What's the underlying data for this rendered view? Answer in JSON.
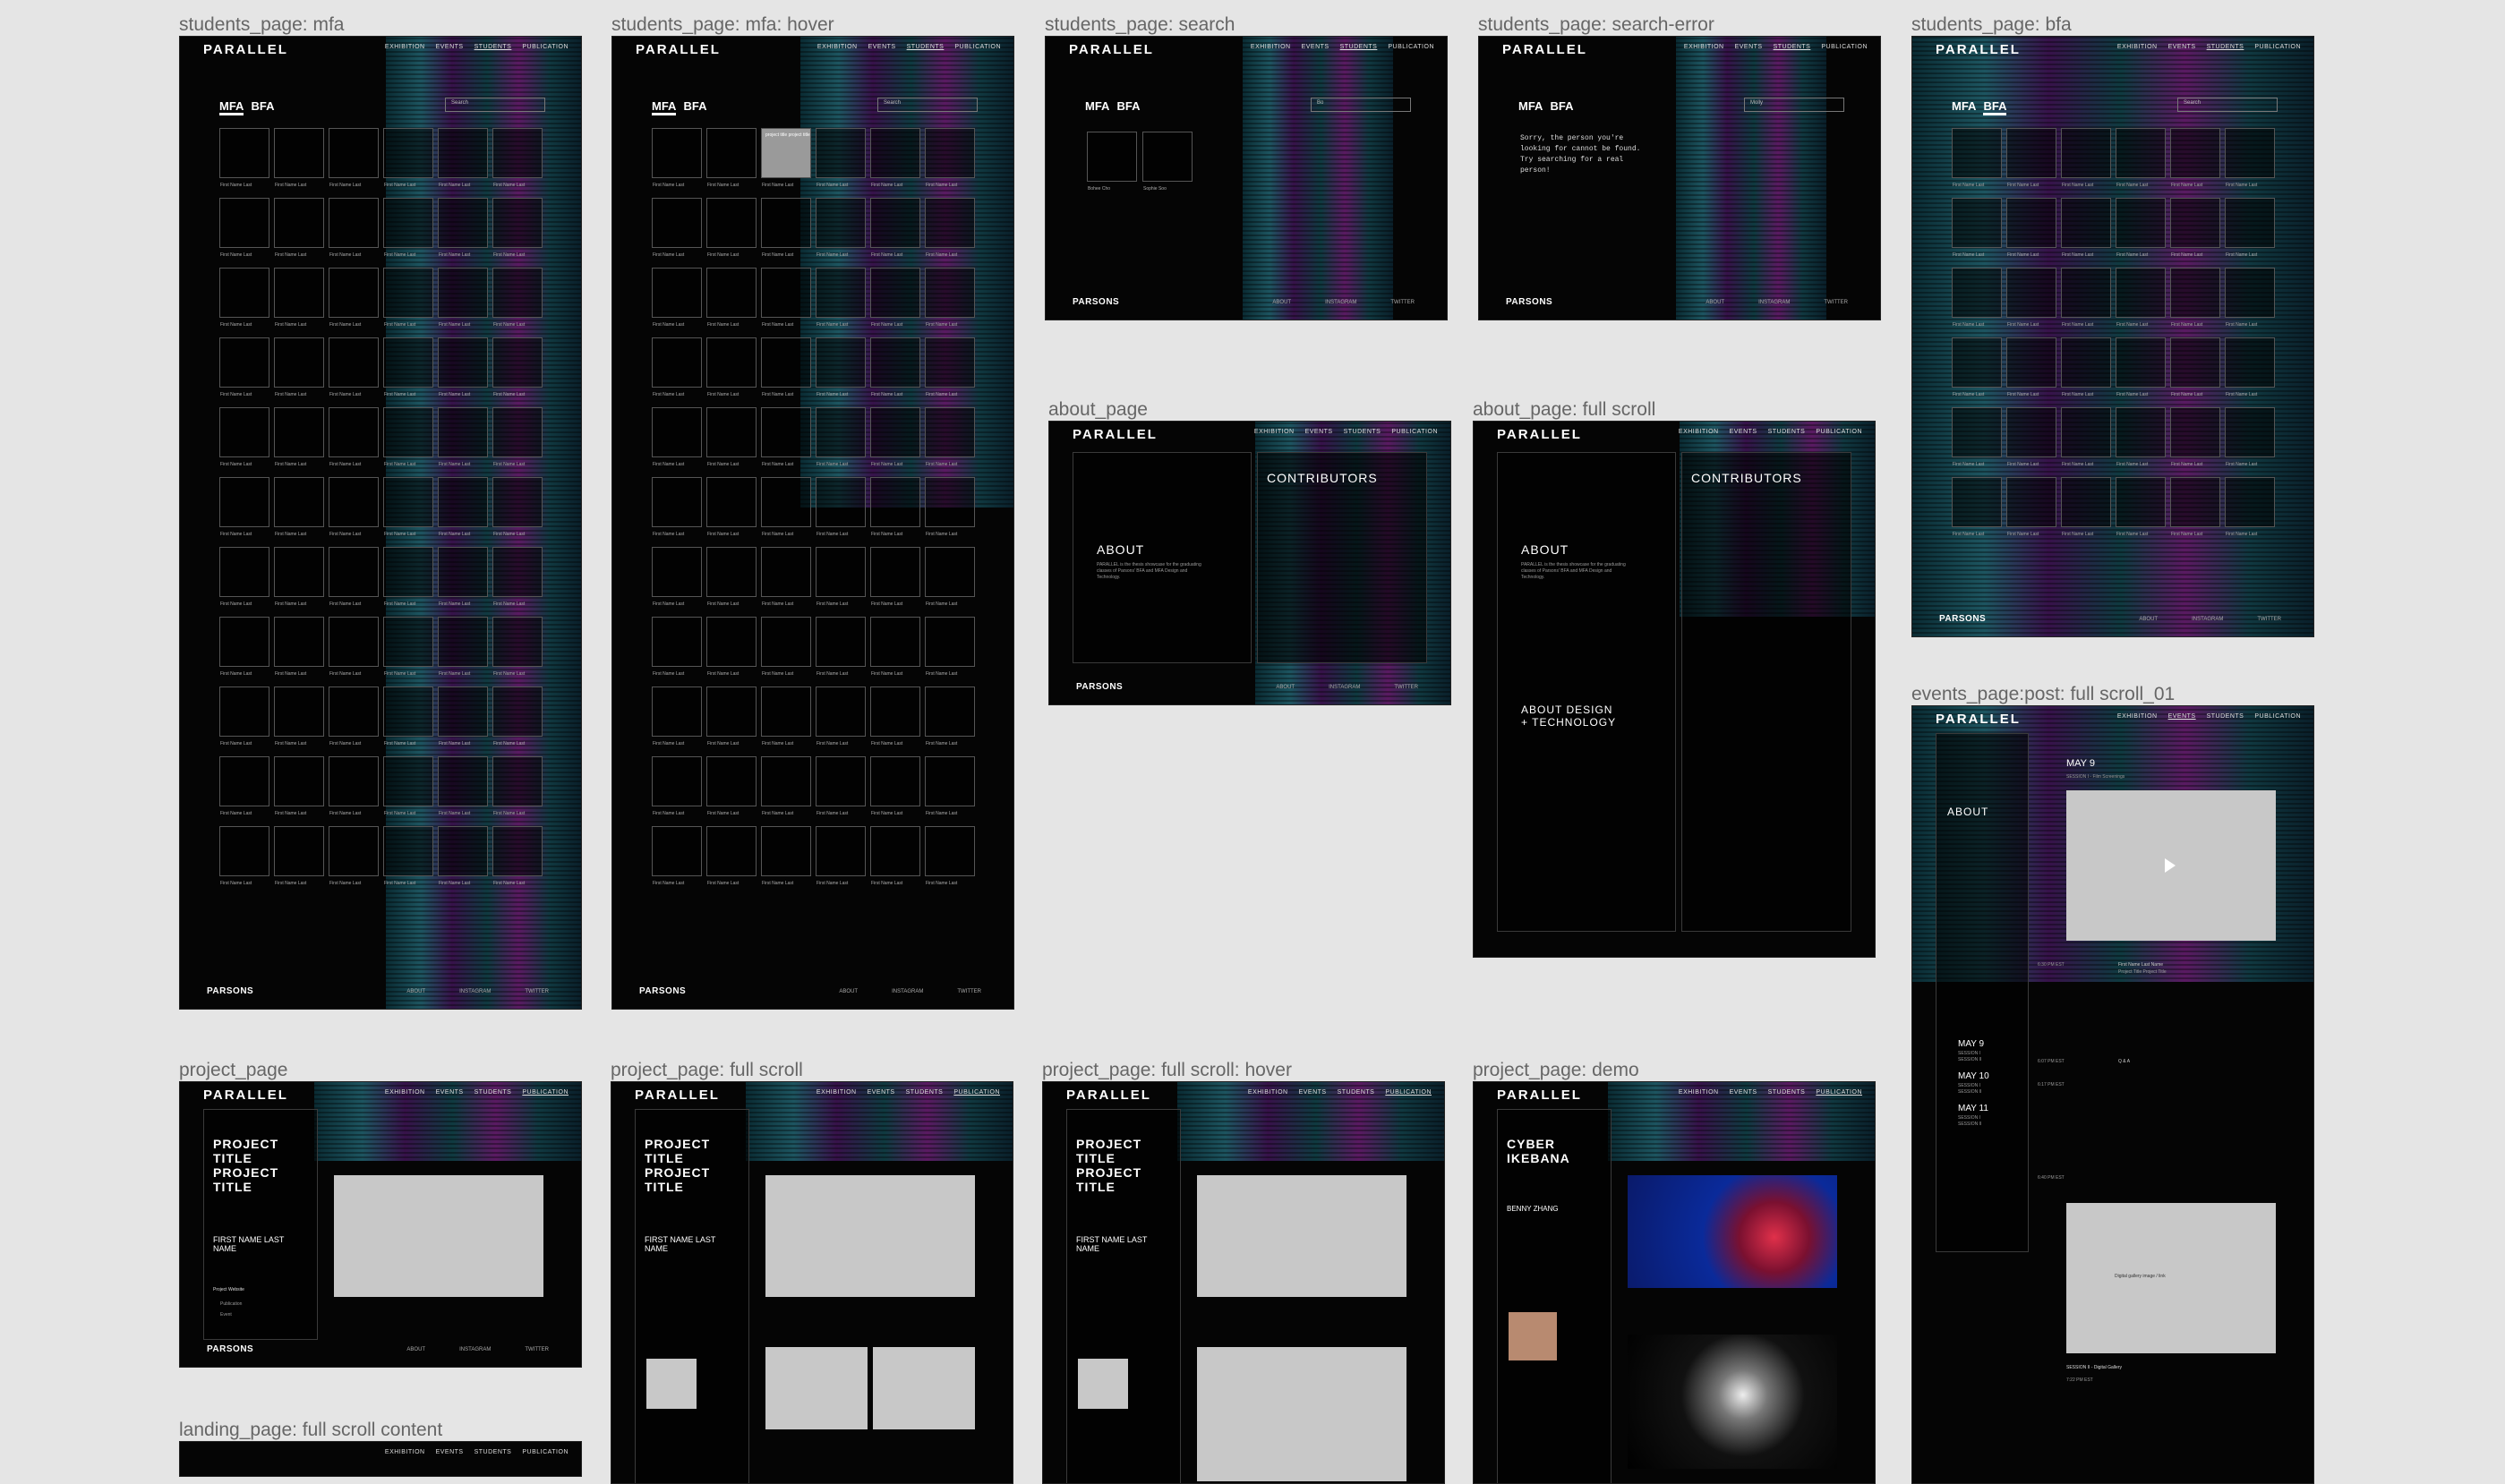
{
  "frames": {
    "mfa": "students_page: mfa",
    "mfa_hover": "students_page: mfa: hover",
    "search": "students_page: search",
    "search_error": "students_page: search-error",
    "bfa": "students_page: bfa",
    "about": "about_page",
    "about_full": "about_page: full scroll",
    "events": "events_page:post: full scroll_01",
    "project": "project_page",
    "project_full": "project_page: full scroll",
    "project_hover": "project_page: full scroll: hover",
    "project_demo": "project_page: demo",
    "landing": "landing_page: full scroll content"
  },
  "site": {
    "logo": "PARALLEL",
    "nav": [
      "EXHIBITION",
      "EVENTS",
      "STUDENTS",
      "PUBLICATION"
    ],
    "footer_logo": "PARSONS",
    "footer_links": [
      "ABOUT",
      "INSTAGRAM",
      "TWITTER"
    ]
  },
  "students": {
    "tab_mfa": "MFA",
    "tab_bfa": "BFA",
    "search_placeholder": "Search",
    "cell_name": "First Name Last",
    "hover_text": "project title project title",
    "search_value": "Bo",
    "search_results": [
      "Bohee Cho",
      "Sophie Soo"
    ],
    "error_value": "Molly",
    "error_message": "Sorry, the person you're looking for cannot be found. Try searching for a real person!"
  },
  "about": {
    "title": "ABOUT",
    "contributors": "CONTRIBUTORS",
    "section2": "ABOUT DESIGN + TECHNOLOGY",
    "body": "PARALLEL is the thesis showcase for the graduating classes of Parsons' BFA and MFA Design and Technology."
  },
  "events": {
    "day": "MAY 9",
    "session": "SESSION I - Film Screenings",
    "about": "ABOUT",
    "dates": [
      "MAY 9",
      "MAY 10",
      "MAY 11"
    ],
    "sessions": [
      "SESSION I",
      "SESSION II"
    ],
    "times": [
      "6:30 PM EST",
      "6:07 PM EST",
      "6:17 PM EST",
      "6:40 PM EST",
      "7:22 PM EST"
    ],
    "qa": "Q & A",
    "entry": "First Name Last Name",
    "entry_sub": "Project Title Project Title",
    "gallery": "Digital gallery image / link",
    "session2": "SESSION II - Digital Gallery"
  },
  "project": {
    "title": "PROJECT TITLE PROJECT TITLE",
    "name": "FIRST NAME LAST NAME",
    "website": "Project Website",
    "pub": "Publication",
    "event": "Event",
    "demo_title": "CYBER IKEBANA",
    "demo_name": "BENNY ZHANG"
  }
}
